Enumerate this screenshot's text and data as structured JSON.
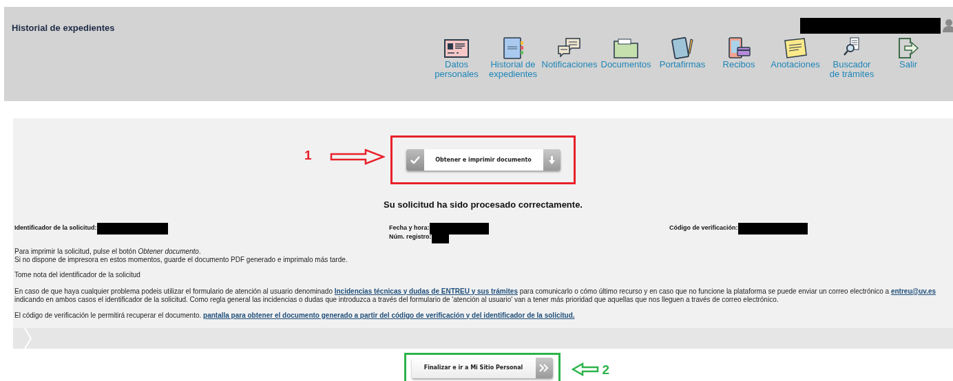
{
  "header": {
    "title": "Historial de expedientes",
    "nav": [
      {
        "label": "Datos personales",
        "kind": "card"
      },
      {
        "label": "Historial de expedientes",
        "kind": "binder"
      },
      {
        "label": "Notificaciones",
        "kind": "chat"
      },
      {
        "label": "Documentos",
        "kind": "folder"
      },
      {
        "label": "Portafirmas",
        "kind": "tablet"
      },
      {
        "label": "Recibos",
        "kind": "phone"
      },
      {
        "label": "Anotaciones",
        "kind": "note"
      },
      {
        "label": "Buscador de trámites",
        "kind": "finder"
      },
      {
        "label": "Salir",
        "kind": "exit"
      }
    ]
  },
  "print_button": {
    "label": "Obtener e imprimir documento",
    "marker": "1"
  },
  "success_message": "Su solicitud ha sido procesado correctamente.",
  "details": [
    {
      "fields": [
        {
          "label": "Identificador de la solicitud:"
        }
      ]
    },
    {
      "fields": [
        {
          "label": "Fecha y hora:"
        },
        {
          "label": "Núm. registro:"
        }
      ]
    },
    {
      "fields": [
        {
          "label": "Código de verificación:"
        }
      ]
    }
  ],
  "paragraphs": [
    {
      "segments": [
        {
          "kind": "text",
          "text": "Para imprimir la solicitud, pulse el botón *Obtener documento*."
        }
      ]
    },
    {
      "segments": [
        {
          "kind": "text",
          "text": "Si no dispone de impresora en estos momentos, guarde el documento PDF generado e imprimalo más tarde."
        }
      ]
    },
    {
      "segments": [
        {
          "kind": "text",
          "text": "Tome nota del identificador de la solicitud"
        }
      ]
    },
    {
      "segments": [
        {
          "kind": "text",
          "text": "En caso de que haya cualquier problema podeis utilizar el formulario de atención al usuario denominado "
        },
        {
          "kind": "link",
          "text": "Incidencias técnicas y dudas de ENTREU y sus trámites"
        },
        {
          "kind": "text",
          "text": " para comunicarlo o cómo último recurso y en caso que no funcione la plataforma se puede enviar un correo electrónico a "
        },
        {
          "kind": "link",
          "text": "entreu@uv.es"
        },
        {
          "kind": "text",
          "text": " indicando en ambos casos el identificador de la solicitud. Como regla general las incidencias o dudas que introduzca a través del formulario de 'atención al usuario' van a tener más prioridad que aquellas que nos lleguen a través de correo electrónico."
        }
      ]
    },
    {
      "segments": [
        {
          "kind": "text",
          "text": "El código de verificación le permitirá recuperar el documento. "
        },
        {
          "kind": "link",
          "text": "pantalla para obtener el documento generado a partir del código de verificación y del identificador de la solicitud."
        }
      ]
    }
  ],
  "finish_button": {
    "label": "Finalizar e ir a Mi Sitio Personal",
    "marker": "2"
  }
}
